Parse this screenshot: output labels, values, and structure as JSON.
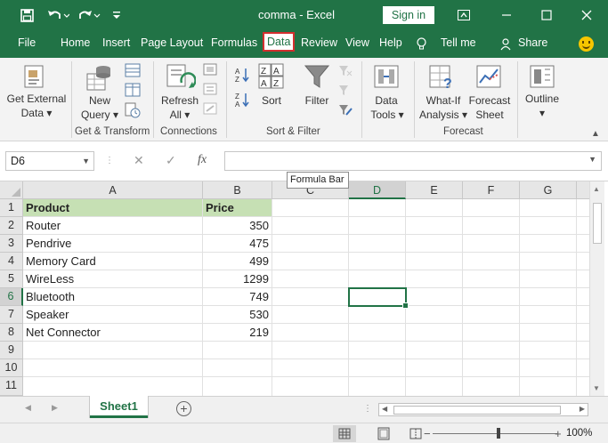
{
  "window": {
    "doc_title": "comma  -  Excel",
    "signin_label": "Sign in"
  },
  "tabs": [
    {
      "label": "File"
    },
    {
      "label": "Home"
    },
    {
      "label": "Insert"
    },
    {
      "label": "Page Layout"
    },
    {
      "label": "Formulas"
    },
    {
      "label": "Data",
      "active": true
    },
    {
      "label": "Review"
    },
    {
      "label": "View"
    },
    {
      "label": "Help"
    },
    {
      "label": "Tell me"
    },
    {
      "label": "Share"
    }
  ],
  "ribbon": {
    "get_external_data": {
      "line1": "Get External",
      "line2": "Data ▾"
    },
    "new_query": {
      "line1": "New",
      "line2": "Query ▾"
    },
    "refresh_all": {
      "line1": "Refresh",
      "line2": "All ▾"
    },
    "sort": "Sort",
    "filter": "Filter",
    "data_tools": {
      "line1": "Data",
      "line2": "Tools ▾"
    },
    "what_if": {
      "line1": "What-If",
      "line2": "Analysis ▾"
    },
    "forecast_sheet": {
      "line1": "Forecast",
      "line2": "Sheet"
    },
    "outline": {
      "line1": "Outline",
      "line2": "▾"
    },
    "groups": {
      "get_transform": "Get & Transform",
      "connections": "Connections",
      "sort_filter": "Sort & Filter",
      "forecast": "Forecast"
    }
  },
  "formula_bar": {
    "name_box": "D6",
    "fx_label": "fx",
    "value": "",
    "tooltip": "Formula Bar"
  },
  "grid": {
    "columns": [
      "A",
      "B",
      "C",
      "D",
      "E",
      "F",
      "G"
    ],
    "rows": [
      "1",
      "2",
      "3",
      "4",
      "5",
      "6",
      "7",
      "8",
      "9",
      "10",
      "11"
    ],
    "header": {
      "product": "Product",
      "price": "Price"
    },
    "data": [
      {
        "product": "Router",
        "price": "350"
      },
      {
        "product": "Pendrive",
        "price": "475"
      },
      {
        "product": "Memory Card",
        "price": "499"
      },
      {
        "product": "WireLess",
        "price": "1299"
      },
      {
        "product": "Bluetooth",
        "price": "749"
      },
      {
        "product": "Speaker",
        "price": "530"
      },
      {
        "product": "Net Connector",
        "price": "219"
      }
    ],
    "active_cell": "D6"
  },
  "sheets": [
    "Sheet1"
  ],
  "status": {
    "zoom": "100%"
  },
  "colors": {
    "accent": "#217346",
    "header_fill": "#c6e0b4",
    "highlight": "#d32f2f"
  }
}
